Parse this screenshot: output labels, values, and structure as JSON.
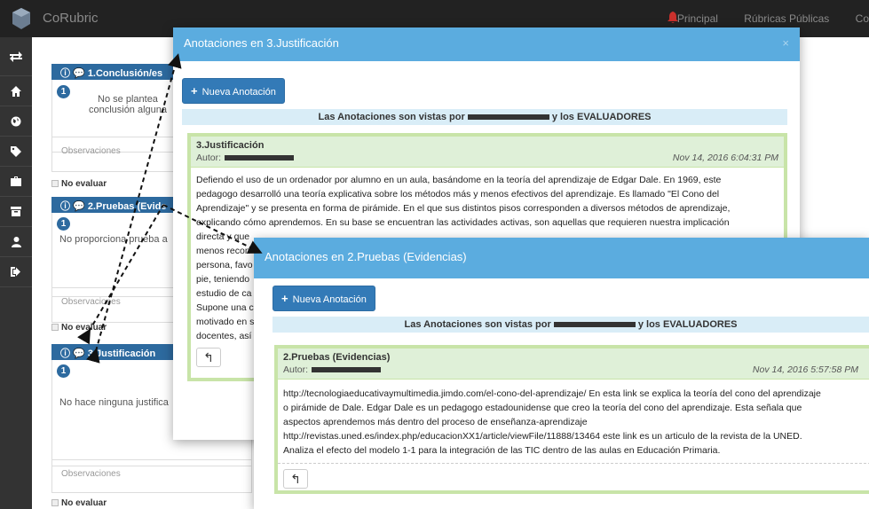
{
  "navbar": {
    "brand": "CoRubric",
    "links": [
      "Principal",
      "Rúbricas Públicas",
      "Co"
    ]
  },
  "sidebar": {
    "items": [
      "exchange-icon",
      "home-icon",
      "globe-icon",
      "tags-icon",
      "briefcase-icon",
      "archive-icon",
      "user-icon",
      "sign-out-icon"
    ]
  },
  "background": {
    "criteria": [
      {
        "title": "1.Conclusión/es",
        "badge": "1",
        "text": "No se plantea conclusión alguna"
      },
      {
        "title": "2.Pruebas (Evide",
        "badge": "1",
        "text": "No proporciona prueba a"
      },
      {
        "title": "3.Justificación",
        "badge": "1",
        "text": "No hace ninguna justifica"
      }
    ],
    "observaciones": "Observaciones",
    "no_evaluar": "No evaluar"
  },
  "modal1": {
    "title": "Anotaciones en 3.Justificación",
    "new_button": "Nueva Anotación",
    "info_prefix": "Las Anotaciones son vistas por",
    "info_suffix": "y los EVALUADORES",
    "note": {
      "title": "3.Justificación",
      "author_label": "Autor:",
      "date": "Nov 14, 2016 6:04:31 PM",
      "lines": [
        "Defiendo el uso de un ordenador por alumno en un aula, basándome en la teoría del aprendizaje de Edgar Dale. En 1969, este",
        "pedagogo desarrolló una teoría explicativa sobre los métodos más y menos efectivos del aprendizaje. Es llamado \"El Cono del",
        "Aprendizaje\" y se presenta en forma de pirámide. En el que sus distintos pisos corresponden a diversos métodos de aprendizaje,",
        "explicando cómo aprendemos. En su base se encuentran las actividades activas, son aquellas que requieren nuestra implicación",
        "directa y que",
        "menos recon",
        "persona, favo",
        "pie, teniendo",
        "estudio de ca",
        "Supone una c",
        "motivado en s",
        "docentes, así"
      ]
    }
  },
  "modal2": {
    "title": "Anotaciones en 2.Pruebas (Evidencias)",
    "new_button": "Nueva Anotación",
    "info_prefix": "Las Anotaciones son vistas por",
    "info_suffix": "y los EVALUADORES",
    "note": {
      "title": "2.Pruebas (Evidencias)",
      "author_label": "Autor:",
      "date": "Nov 14, 2016 5:57:58 PM",
      "lines": [
        "http://tecnologiaeducativaymultimedia.jimdo.com/el-cono-del-aprendizaje/ En esta link se explica la teoría del cono del aprendizaje",
        "o pirámide de Dale. Edgar Dale es un pedagogo estadounidense que creo la teoría del cono del aprendizaje. Esta señala que",
        "aspectos aprendemos más dentro del proceso de enseñanza-aprendizaje",
        "http://revistas.uned.es/index.php/educacionXX1/article/viewFile/11888/13464 este link es un articulo de la revista de la UNED.",
        "Analiza el efecto del modelo 1-1 para la integración de las TIC dentro de las aulas en Educación Primaria."
      ]
    }
  }
}
